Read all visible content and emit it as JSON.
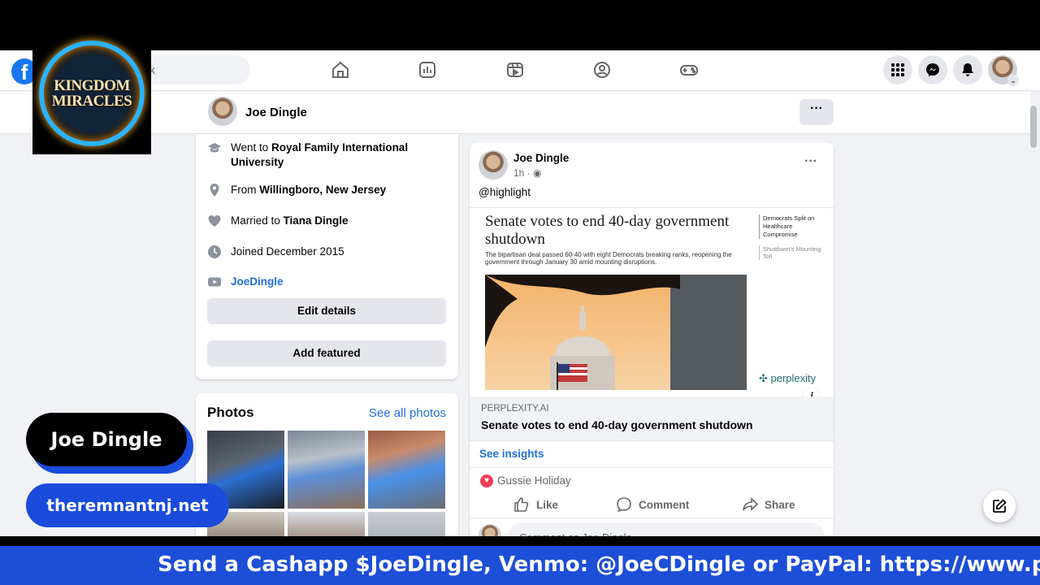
{
  "nav": {
    "logo": "f",
    "search_placeholder": "k",
    "icons": [
      "home-icon",
      "pages-icon",
      "video-icon",
      "groups-icon",
      "gaming-icon"
    ],
    "right_icons": [
      "menu-grid-icon",
      "messenger-icon",
      "notifications-icon"
    ]
  },
  "profile_header": {
    "name": "Joe Dingle",
    "more": "···"
  },
  "intro": {
    "education_prefix": "Went to ",
    "education": "Royal Family International University",
    "from_prefix": "From ",
    "from": "Willingboro, New Jersey",
    "married_prefix": "Married to ",
    "married": "Tiana Dingle",
    "joined": "Joined December 2015",
    "youtube": "JoeDingle",
    "edit_details": "Edit details",
    "add_featured": "Add featured"
  },
  "photos": {
    "title": "Photos",
    "see_all": "See all photos"
  },
  "post": {
    "author": "Joe Dingle",
    "time": "1h · ",
    "more": "···",
    "text": "@highlight",
    "image": {
      "headline": "Senate votes to end 40-day government shutdown",
      "subline": "The bipartisan deal passed 60-40 with eight Democrats breaking ranks, reopening the government through January 30 amid mounting disruptions.",
      "side1": "Democrats Split on Healthcare Compromise",
      "side2": "Shutdown's Mounting Toll",
      "brand": "perplexity",
      "info": "i"
    },
    "link_domain": "PERPLEXITY.AI",
    "link_title": "Senate votes to end 40-day government shutdown",
    "insights": "See insights",
    "reaction_name": "Gussie Holiday",
    "like": "Like",
    "comment": "Comment",
    "share": "Share",
    "comment_placeholder": "Comment as Joe Dingle"
  },
  "overlays": {
    "logo_line1": "KINGDOM",
    "logo_line2": "MIRACLES",
    "name_pill": "Joe Dingle",
    "url_pill": "theremnantnj.net",
    "ticker": "Send a Cashapp $JoeDingle, Venmo: @JoeCDingle or PayPal: https://www.pay"
  },
  "colors": {
    "fb_blue": "#1877f2",
    "link_blue": "#216fdb",
    "ticker_blue": "#1d4ed8",
    "heart_red": "#f33e58"
  }
}
